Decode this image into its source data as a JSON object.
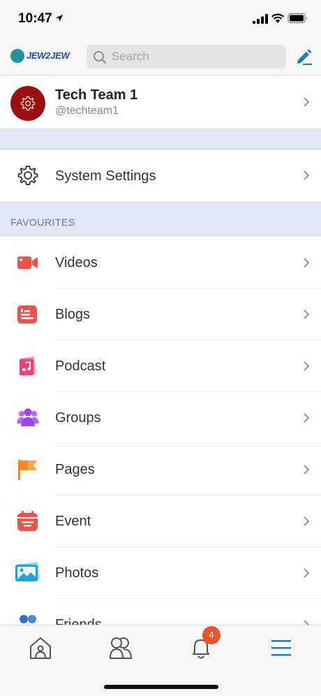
{
  "status": {
    "time": "10:47"
  },
  "header": {
    "logo_text": "JEW2JEW",
    "search_placeholder": "Search"
  },
  "profile": {
    "name": "Tech Team 1",
    "handle": "@techteam1"
  },
  "settings": {
    "label": "System Settings"
  },
  "favourites": {
    "title": "FAVOURITES",
    "items": [
      {
        "label": "Videos",
        "icon": "video-icon",
        "color": "#f0524a"
      },
      {
        "label": "Blogs",
        "icon": "blog-icon",
        "color": "#f0524a"
      },
      {
        "label": "Podcast",
        "icon": "podcast-icon",
        "color": "#ec407a"
      },
      {
        "label": "Groups",
        "icon": "groups-icon",
        "color": "#a046e8"
      },
      {
        "label": "Pages",
        "icon": "pages-flag-icon",
        "color": "#f58a1f"
      },
      {
        "label": "Event",
        "icon": "event-calendar-icon",
        "color": "#f0524a"
      },
      {
        "label": "Photos",
        "icon": "photos-icon",
        "color": "#1fa3d9"
      },
      {
        "label": "Friends",
        "icon": "friends-icon",
        "color": "#2f6fd0"
      }
    ]
  },
  "tabbar": {
    "notification_count": "4"
  },
  "colors": {
    "accent": "#1a7fc1",
    "avatar": "#9a0f0f",
    "section_bg": "#dfe8f3",
    "badge": "#e8552a"
  }
}
